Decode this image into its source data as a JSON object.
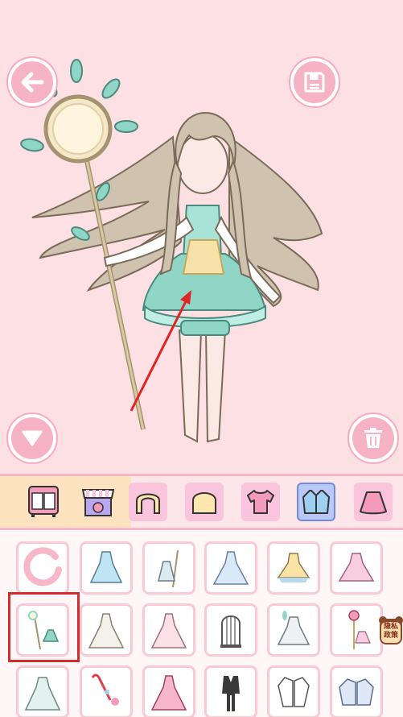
{
  "topbar": {
    "back_icon": "arrow-left-icon",
    "save_icon": "floppy-disk-icon"
  },
  "stage_controls": {
    "collapse_icon": "triangle-down-icon",
    "trash_icon": "trash-can-icon"
  },
  "categories": [
    {
      "name": "wardrobe",
      "icon": "wardrobe-icon",
      "active": false
    },
    {
      "name": "shop",
      "icon": "shop-icon",
      "active": false
    },
    {
      "name": "hair-back",
      "icon": "hair-back-icon",
      "active": false
    },
    {
      "name": "hair-front",
      "icon": "hair-front-icon",
      "active": false
    },
    {
      "name": "top",
      "icon": "shirt-icon",
      "active": false
    },
    {
      "name": "jacket",
      "icon": "jacket-icon",
      "active": true
    },
    {
      "name": "skirt",
      "icon": "skirt-icon",
      "active": false
    }
  ],
  "items": [
    "reset-icon",
    "blue-dress",
    "staff-outfit",
    "ice-gown",
    "yellow-dress",
    "pink-dress",
    "green-staff-outfit",
    "white-gown",
    "pink-ballgown",
    "birdcage",
    "leaf-dress",
    "rose-wand",
    "lace-dress",
    "candy-wand",
    "rose-gown",
    "butler-suit",
    "white-hoodie",
    "blue-jacket"
  ],
  "badge": {
    "line1": "隐私",
    "line2": "政策"
  },
  "colors": {
    "accent": "#f7a9bf",
    "background": "#fde0e3",
    "selection": "#d62b2b"
  }
}
